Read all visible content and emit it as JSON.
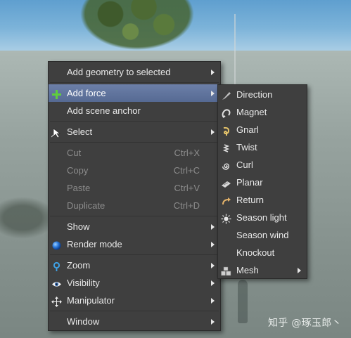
{
  "background": {
    "watermark": "知乎 @琢玉郎丶"
  },
  "main_menu": {
    "add_geometry": "Add geometry to selected",
    "add_force": "Add force",
    "add_scene_anchor": "Add scene anchor",
    "select": "Select",
    "cut": "Cut",
    "cut_shortcut": "Ctrl+X",
    "copy": "Copy",
    "copy_shortcut": "Ctrl+C",
    "paste": "Paste",
    "paste_shortcut": "Ctrl+V",
    "duplicate": "Duplicate",
    "duplicate_shortcut": "Ctrl+D",
    "show": "Show",
    "render_mode": "Render mode",
    "zoom": "Zoom",
    "visibility": "Visibility",
    "manipulator": "Manipulator",
    "window": "Window"
  },
  "force_submenu": {
    "items": [
      "Direction",
      "Magnet",
      "Gnarl",
      "Twist",
      "Curl",
      "Planar",
      "Return",
      "Season light",
      "Season wind",
      "Knockout",
      "Mesh"
    ]
  },
  "colors": {
    "menu_bg": "#3f3f3f",
    "highlight": "#5f729b",
    "text": "#e9e9e9",
    "disabled_text": "#8c8c8c"
  },
  "icons": {
    "add_force": "plus-icon",
    "select": "cursor-icon",
    "render_mode": "blue-sphere-icon",
    "zoom": "magnifier-icon",
    "visibility": "eye-icon",
    "manipulator": "move-arrows-icon",
    "direction": "direction-brush-icon",
    "magnet": "magnet-icon",
    "gnarl": "gnarl-icon",
    "twist": "twist-icon",
    "curl": "curl-spiral-icon",
    "planar": "planar-icon",
    "return": "return-arrow-icon",
    "season_light": "sun-icon",
    "mesh": "mesh-blocks-icon"
  }
}
